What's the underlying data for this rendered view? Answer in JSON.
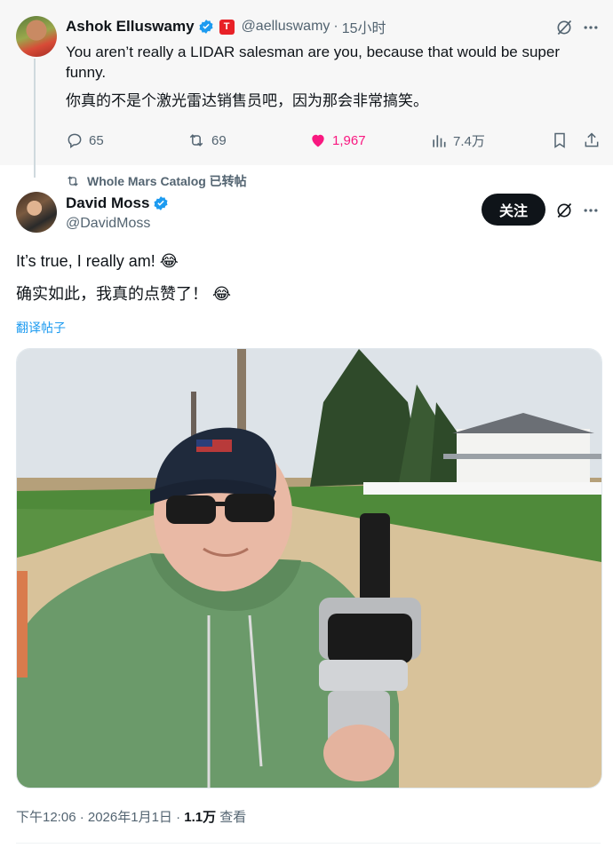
{
  "top_tweet": {
    "author_name": "Ashok Elluswamy",
    "handle": "@aelluswamy",
    "time": "15小时",
    "text_en": "You aren’t really a LIDAR salesman are you, because that would be super funny.",
    "text_zh": "你真的不是个激光雷达销售员吧，因为那会非常搞笑。",
    "replies": "65",
    "reposts": "69",
    "likes": "1,967",
    "views": "7.4万",
    "like_color": "#f91880"
  },
  "retweet_label": "Whole Mars Catalog 已转帖",
  "main_tweet": {
    "author_name": "David Moss",
    "handle": "@DavidMoss",
    "follow_label": "关注",
    "text_en": "It’s true, I really am! 😂",
    "text_zh": "确实如此，我真的点赞了！ 😂",
    "translate_label": "翻译帖子",
    "timestamp": "下午12:06 · 2026年1月1日 · ",
    "views_count": "1.1万",
    "views_label": " 查看"
  },
  "colors": {
    "verified": "#1d9bf0",
    "link": "#1d9bf0",
    "tesla": "#e82127"
  },
  "icons": [
    "grok-icon",
    "reply-icon",
    "repost-icon",
    "heart-icon",
    "views-icon",
    "bookmark-icon",
    "share-icon",
    "more-icon",
    "verified-icon"
  ]
}
